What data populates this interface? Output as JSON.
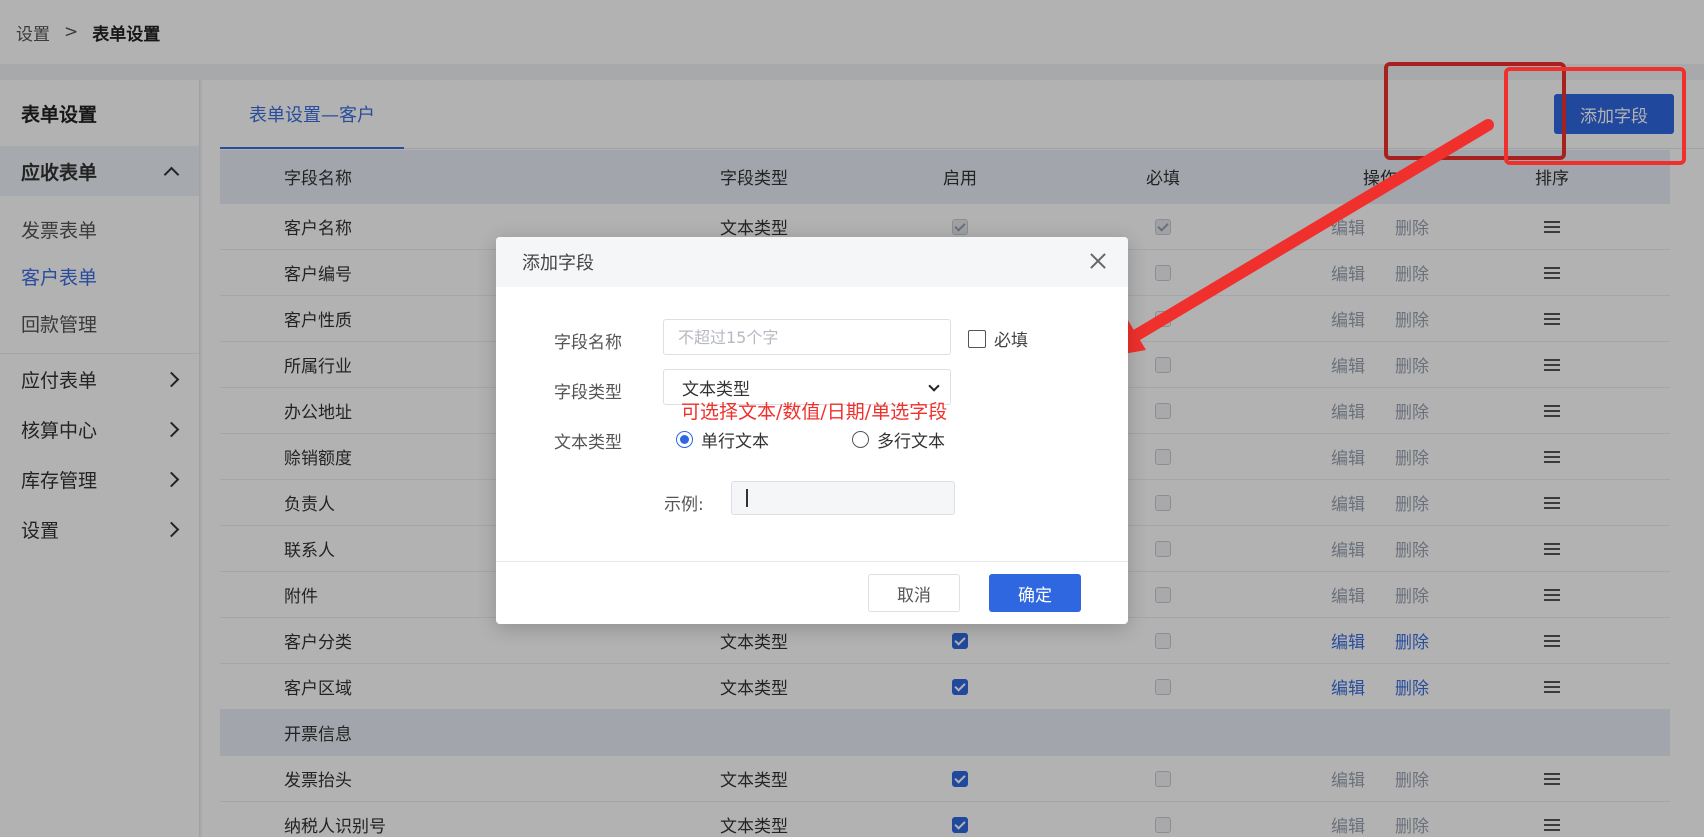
{
  "breadcrumb": {
    "root": "设置",
    "sep": ">",
    "current": "表单设置"
  },
  "sidebar": {
    "title": "表单设置",
    "open_group": "应收表单",
    "sub_items": [
      "发票表单",
      "客户表单",
      "回款管理"
    ],
    "active_sub": "客户表单",
    "groups": [
      "应付表单",
      "核算中心",
      "库存管理",
      "设置"
    ]
  },
  "main": {
    "tab": "表单设置—客户",
    "add_button": "添加字段"
  },
  "table": {
    "headers": [
      "字段名称",
      "字段类型",
      "启用",
      "必填",
      "操作",
      "排序"
    ],
    "edit_label": "编辑",
    "delete_label": "删除",
    "rows": [
      {
        "name": "客户名称",
        "type": "文本类型",
        "enabled": true,
        "required": true,
        "locked": true
      },
      {
        "name": "客户编号",
        "type": "",
        "enabled": true,
        "required": false,
        "locked": true
      },
      {
        "name": "客户性质",
        "type": "",
        "enabled": true,
        "required": false,
        "locked": true
      },
      {
        "name": "所属行业",
        "type": "",
        "enabled": true,
        "required": false,
        "locked": true
      },
      {
        "name": "办公地址",
        "type": "",
        "enabled": true,
        "required": false,
        "locked": true
      },
      {
        "name": "赊销额度",
        "type": "",
        "enabled": true,
        "required": false,
        "locked": true
      },
      {
        "name": "负责人",
        "type": "",
        "enabled": true,
        "required": false,
        "locked": true
      },
      {
        "name": "联系人",
        "type": "",
        "enabled": true,
        "required": false,
        "locked": true
      },
      {
        "name": "附件",
        "type": "",
        "enabled": true,
        "required": false,
        "locked": true
      },
      {
        "name": "客户分类",
        "type": "文本类型",
        "enabled": true,
        "required": false,
        "locked": false
      },
      {
        "name": "客户区域",
        "type": "文本类型",
        "enabled": true,
        "required": false,
        "locked": false
      }
    ],
    "section": "开票信息",
    "section_rows": [
      {
        "name": "发票抬头",
        "type": "文本类型",
        "enabled": true,
        "required": false,
        "locked": true
      },
      {
        "name": "纳税人识别号",
        "type": "文本类型",
        "enabled": true,
        "required": false,
        "locked": true
      }
    ]
  },
  "dialog": {
    "title": "添加字段",
    "field_name_label": "字段名称",
    "field_name_placeholder": "不超过15个字",
    "required_label": "必填",
    "field_type_label": "字段类型",
    "field_type_value": "文本类型",
    "hint": "可选择文本/数值/日期/单选字段",
    "text_type_label": "文本类型",
    "radio_single": "单行文本",
    "radio_multi": "多行文本",
    "example_label": "示例:",
    "cancel": "取消",
    "ok": "确定"
  },
  "colors": {
    "accent": "#2f67e0",
    "annotation": "#f0302c"
  }
}
